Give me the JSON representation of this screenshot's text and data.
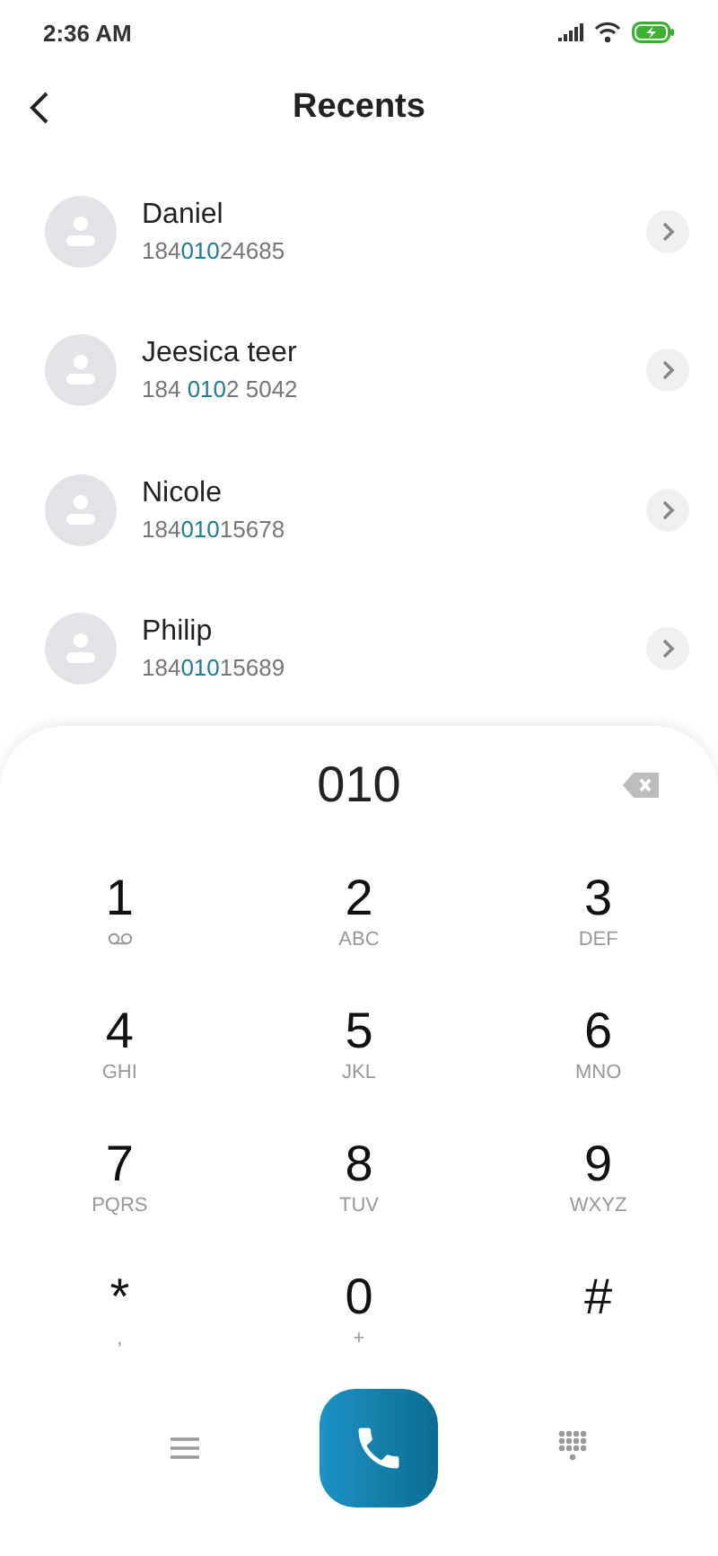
{
  "status_bar": {
    "time": "2:36 AM"
  },
  "header": {
    "title": "Recents"
  },
  "contacts": [
    {
      "name": "Daniel",
      "number": {
        "prefix": "184",
        "match": "010",
        "suffix": "24685"
      }
    },
    {
      "name": "Jeesica teer",
      "number": {
        "prefix": "184 ",
        "match": "010",
        "suffix": "2 5042"
      }
    },
    {
      "name": "Nicole",
      "number": {
        "prefix": "184",
        "match": "010",
        "suffix": "15678"
      }
    },
    {
      "name": "Philip",
      "number": {
        "prefix": "184",
        "match": "010",
        "suffix": "15689"
      }
    }
  ],
  "dialpad": {
    "entered": "010",
    "keys": [
      {
        "digit": "1",
        "kind": "voicemail"
      },
      {
        "digit": "2",
        "kind": "letters",
        "sub": "ABC"
      },
      {
        "digit": "3",
        "kind": "letters",
        "sub": "DEF"
      },
      {
        "digit": "4",
        "kind": "letters",
        "sub": "GHI"
      },
      {
        "digit": "5",
        "kind": "letters",
        "sub": "JKL"
      },
      {
        "digit": "6",
        "kind": "letters",
        "sub": "MNO"
      },
      {
        "digit": "7",
        "kind": "letters",
        "sub": "PQRS"
      },
      {
        "digit": "8",
        "kind": "letters",
        "sub": "TUV"
      },
      {
        "digit": "9",
        "kind": "letters",
        "sub": "WXYZ"
      },
      {
        "digit": "*",
        "kind": "letters",
        "sub": ","
      },
      {
        "digit": "0",
        "kind": "letters",
        "sub": "+"
      },
      {
        "digit": "#",
        "kind": "plain"
      }
    ]
  }
}
